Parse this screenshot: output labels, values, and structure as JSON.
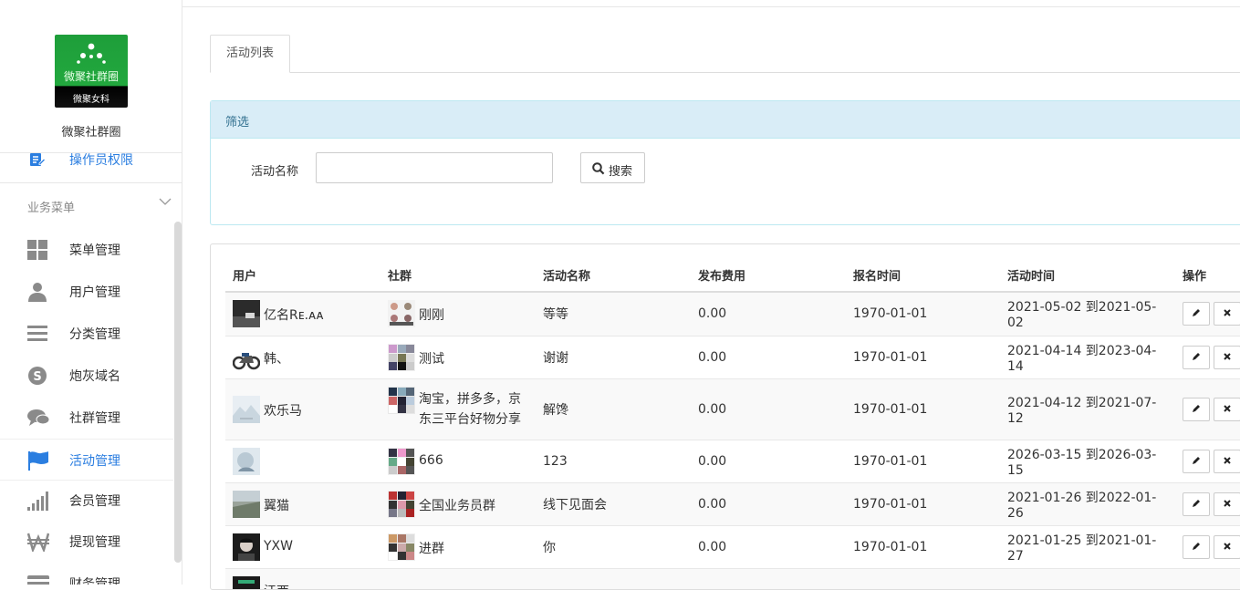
{
  "brand": {
    "logo_text": "微聚社群圈",
    "logo_sub": "微聚女科",
    "name": "微聚社群圈"
  },
  "sidebar": {
    "top_item": {
      "label": "操作员权限",
      "icon": "edit-icon"
    },
    "group_label": "业务菜单",
    "items": [
      {
        "label": "菜单管理",
        "icon": "grid-icon",
        "active": false
      },
      {
        "label": "用户管理",
        "icon": "user-icon",
        "active": false
      },
      {
        "label": "分类管理",
        "icon": "list-icon",
        "active": false
      },
      {
        "label": "炮灰域名",
        "icon": "skype-icon",
        "active": false
      },
      {
        "label": "社群管理",
        "icon": "chat-icon",
        "active": false
      },
      {
        "label": "活动管理",
        "icon": "flag-icon",
        "active": true
      },
      {
        "label": "会员管理",
        "icon": "signal-icon",
        "active": false
      },
      {
        "label": "提现管理",
        "icon": "won-icon",
        "active": false
      },
      {
        "label": "财务管理",
        "icon": "card-icon",
        "active": false
      }
    ]
  },
  "tabs": [
    {
      "label": "活动列表",
      "active": true
    }
  ],
  "filter": {
    "title": "筛选",
    "field_label": "活动名称",
    "field_value": "",
    "search_label": "搜索"
  },
  "table": {
    "headers": [
      "用户",
      "社群",
      "活动名称",
      "发布费用",
      "报名时间",
      "活动时间",
      "操作"
    ],
    "rows": [
      {
        "user": "亿名Rᴇ.ᴀᴀ",
        "group": "刚刚",
        "activity": "等等",
        "fee": "0.00",
        "signup": "1970-01-01",
        "time": "2021-05-02 到2021-05-02"
      },
      {
        "user": "韩、",
        "group": "测试",
        "activity": "谢谢",
        "fee": "0.00",
        "signup": "1970-01-01",
        "time": "2021-04-14 到2023-04-14"
      },
      {
        "user": "欢乐马",
        "group": "淘宝，拼多多，京东三平台好物分享",
        "activity": "解馋",
        "fee": "0.00",
        "signup": "1970-01-01",
        "time": "2021-04-12 到2021-07-12"
      },
      {
        "user": "",
        "group": "666",
        "activity": "123",
        "fee": "0.00",
        "signup": "1970-01-01",
        "time": "2026-03-15 到2026-03-15"
      },
      {
        "user": "翼猫",
        "group": "全国业务员群",
        "activity": "线下见面会",
        "fee": "0.00",
        "signup": "1970-01-01",
        "time": "2021-01-26 到2022-01-26"
      },
      {
        "user": "YXW",
        "group": "进群",
        "activity": "你",
        "fee": "0.00",
        "signup": "1970-01-01",
        "time": "2021-01-25 到2021-01-27"
      },
      {
        "user": "江под",
        "group": "",
        "activity": "",
        "fee": "",
        "signup": "",
        "time": ""
      }
    ],
    "edit_icon": "pencil-icon",
    "delete_icon": "close-icon"
  },
  "colors": {
    "accent": "#2b7ee0",
    "filter_head_bg": "#d9edf7",
    "filter_head_text": "#31708f",
    "logo_green": "#22a83e"
  }
}
